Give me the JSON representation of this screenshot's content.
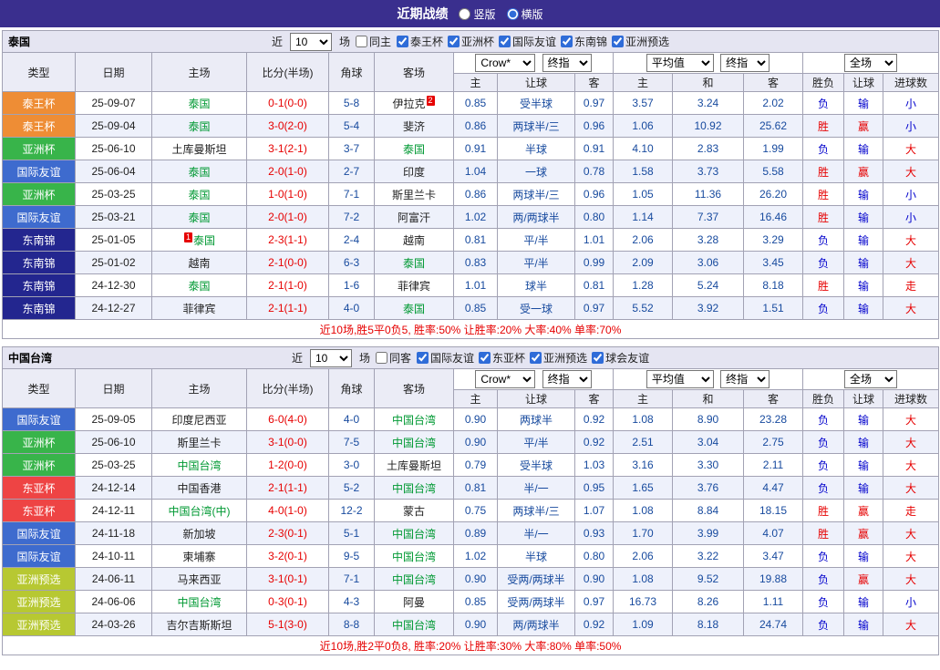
{
  "topbar": {
    "title": "近期战绩",
    "options": [
      {
        "label": "竖版",
        "selected": false
      },
      {
        "label": "横版",
        "selected": true
      }
    ]
  },
  "table_headers": {
    "main": [
      "类型",
      "日期",
      "主场",
      "比分(半场)",
      "角球",
      "客场"
    ],
    "sub": [
      "主",
      "让球",
      "客",
      "主",
      "和",
      "客",
      "胜负",
      "让球",
      "进球数"
    ],
    "dropdowns": {
      "bookmaker": "Crow*",
      "final_odds": "终指",
      "average": "平均值",
      "final_odds2": "终指",
      "scope": "全场"
    }
  },
  "type_colors": {
    "泰王杯": "#ee8d35",
    "亚洲杯": "#38b44a",
    "国际友谊": "#3e6bce",
    "东南锦": "#23268f",
    "东亚杯": "#ee4444",
    "亚洲预选": "#b7c832"
  },
  "colors": {
    "topbar_bg": "#3a2f8e",
    "win_red": "#e60000",
    "loss_blue": "#0000cc",
    "odds_navy": "#174a9e",
    "team_green": "#009933"
  },
  "sections": [
    {
      "team": "泰国",
      "filter": {
        "near": "近",
        "count": "10",
        "games": "场",
        "same_side": "同主",
        "same_checked": false,
        "competitions": [
          "泰王杯",
          "亚洲杯",
          "国际友谊",
          "东南锦",
          "亚洲预选"
        ]
      },
      "rows": [
        {
          "type": "泰王杯",
          "date": "25-09-07",
          "home": {
            "name": "泰国",
            "green": true
          },
          "score": "0-1(0-0)",
          "corner": "5-8",
          "away": {
            "name": "伊拉克",
            "rank": "2"
          },
          "odds": [
            "0.85",
            "受半球",
            "0.97"
          ],
          "avg": [
            "3.57",
            "3.24",
            "2.02"
          ],
          "results": [
            [
              "负",
              "b"
            ],
            [
              "输",
              "b"
            ],
            [
              "小",
              "b"
            ]
          ]
        },
        {
          "type": "泰王杯",
          "date": "25-09-04",
          "home": {
            "name": "泰国",
            "green": true
          },
          "score": "3-0(2-0)",
          "corner": "5-4",
          "away": {
            "name": "斐济"
          },
          "odds": [
            "0.86",
            "两球半/三",
            "0.96"
          ],
          "avg": [
            "1.06",
            "10.92",
            "25.62"
          ],
          "results": [
            [
              "胜",
              "r"
            ],
            [
              "赢",
              "r"
            ],
            [
              "小",
              "b"
            ]
          ]
        },
        {
          "type": "亚洲杯",
          "date": "25-06-10",
          "home": {
            "name": "土库曼斯坦"
          },
          "score": "3-1(2-1)",
          "corner": "3-7",
          "away": {
            "name": "泰国",
            "green": true
          },
          "odds": [
            "0.91",
            "半球",
            "0.91"
          ],
          "avg": [
            "4.10",
            "2.83",
            "1.99"
          ],
          "results": [
            [
              "负",
              "b"
            ],
            [
              "输",
              "b"
            ],
            [
              "大",
              "r"
            ]
          ]
        },
        {
          "type": "国际友谊",
          "date": "25-06-04",
          "home": {
            "name": "泰国",
            "green": true
          },
          "score": "2-0(1-0)",
          "corner": "2-7",
          "away": {
            "name": "印度"
          },
          "odds": [
            "1.04",
            "一球",
            "0.78"
          ],
          "avg": [
            "1.58",
            "3.73",
            "5.58"
          ],
          "results": [
            [
              "胜",
              "r"
            ],
            [
              "赢",
              "r"
            ],
            [
              "大",
              "r"
            ]
          ]
        },
        {
          "type": "亚洲杯",
          "date": "25-03-25",
          "home": {
            "name": "泰国",
            "green": true
          },
          "score": "1-0(1-0)",
          "corner": "7-1",
          "away": {
            "name": "斯里兰卡"
          },
          "odds": [
            "0.86",
            "两球半/三",
            "0.96"
          ],
          "avg": [
            "1.05",
            "11.36",
            "26.20"
          ],
          "results": [
            [
              "胜",
              "r"
            ],
            [
              "输",
              "b"
            ],
            [
              "小",
              "b"
            ]
          ]
        },
        {
          "type": "国际友谊",
          "date": "25-03-21",
          "home": {
            "name": "泰国",
            "green": true
          },
          "score": "2-0(1-0)",
          "corner": "7-2",
          "away": {
            "name": "阿富汗"
          },
          "odds": [
            "1.02",
            "两/两球半",
            "0.80"
          ],
          "avg": [
            "1.14",
            "7.37",
            "16.46"
          ],
          "results": [
            [
              "胜",
              "r"
            ],
            [
              "输",
              "b"
            ],
            [
              "小",
              "b"
            ]
          ]
        },
        {
          "type": "东南锦",
          "date": "25-01-05",
          "home": {
            "name": "泰国",
            "green": true,
            "rank": "1",
            "rank_pos": "before"
          },
          "score": "2-3(1-1)",
          "corner": "2-4",
          "away": {
            "name": "越南"
          },
          "odds": [
            "0.81",
            "平/半",
            "1.01"
          ],
          "avg": [
            "2.06",
            "3.28",
            "3.29"
          ],
          "results": [
            [
              "负",
              "b"
            ],
            [
              "输",
              "b"
            ],
            [
              "大",
              "r"
            ]
          ]
        },
        {
          "type": "东南锦",
          "date": "25-01-02",
          "home": {
            "name": "越南"
          },
          "score": "2-1(0-0)",
          "corner": "6-3",
          "away": {
            "name": "泰国",
            "green": true
          },
          "odds": [
            "0.83",
            "平/半",
            "0.99"
          ],
          "avg": [
            "2.09",
            "3.06",
            "3.45"
          ],
          "results": [
            [
              "负",
              "b"
            ],
            [
              "输",
              "b"
            ],
            [
              "大",
              "r"
            ]
          ]
        },
        {
          "type": "东南锦",
          "date": "24-12-30",
          "home": {
            "name": "泰国",
            "green": true
          },
          "score": "2-1(1-0)",
          "corner": "1-6",
          "away": {
            "name": "菲律宾"
          },
          "odds": [
            "1.01",
            "球半",
            "0.81"
          ],
          "avg": [
            "1.28",
            "5.24",
            "8.18"
          ],
          "results": [
            [
              "胜",
              "r"
            ],
            [
              "输",
              "b"
            ],
            [
              "走",
              "r"
            ]
          ]
        },
        {
          "type": "东南锦",
          "date": "24-12-27",
          "home": {
            "name": "菲律宾"
          },
          "score": "2-1(1-1)",
          "corner": "4-0",
          "away": {
            "name": "泰国",
            "green": true
          },
          "odds": [
            "0.85",
            "受一球",
            "0.97"
          ],
          "avg": [
            "5.52",
            "3.92",
            "1.51"
          ],
          "results": [
            [
              "负",
              "b"
            ],
            [
              "输",
              "b"
            ],
            [
              "大",
              "r"
            ]
          ]
        }
      ],
      "summary": "近10场,胜5平0负5, 胜率:50% 让胜率:20% 大率:40% 单率:70%"
    },
    {
      "team": "中国台湾",
      "filter": {
        "near": "近",
        "count": "10",
        "games": "场",
        "same_side": "同客",
        "same_checked": false,
        "competitions": [
          "国际友谊",
          "东亚杯",
          "亚洲预选",
          "球会友谊"
        ]
      },
      "rows": [
        {
          "type": "国际友谊",
          "date": "25-09-05",
          "home": {
            "name": "印度尼西亚"
          },
          "score": "6-0(4-0)",
          "corner": "4-0",
          "away": {
            "name": "中国台湾",
            "green": true
          },
          "odds": [
            "0.90",
            "两球半",
            "0.92"
          ],
          "avg": [
            "1.08",
            "8.90",
            "23.28"
          ],
          "results": [
            [
              "负",
              "b"
            ],
            [
              "输",
              "b"
            ],
            [
              "大",
              "r"
            ]
          ]
        },
        {
          "type": "亚洲杯",
          "date": "25-06-10",
          "home": {
            "name": "斯里兰卡"
          },
          "score": "3-1(0-0)",
          "corner": "7-5",
          "away": {
            "name": "中国台湾",
            "green": true
          },
          "odds": [
            "0.90",
            "平/半",
            "0.92"
          ],
          "avg": [
            "2.51",
            "3.04",
            "2.75"
          ],
          "results": [
            [
              "负",
              "b"
            ],
            [
              "输",
              "b"
            ],
            [
              "大",
              "r"
            ]
          ]
        },
        {
          "type": "亚洲杯",
          "date": "25-03-25",
          "home": {
            "name": "中国台湾",
            "green": true
          },
          "score": "1-2(0-0)",
          "corner": "3-0",
          "away": {
            "name": "土库曼斯坦"
          },
          "odds": [
            "0.79",
            "受半球",
            "1.03"
          ],
          "avg": [
            "3.16",
            "3.30",
            "2.11"
          ],
          "results": [
            [
              "负",
              "b"
            ],
            [
              "输",
              "b"
            ],
            [
              "大",
              "r"
            ]
          ]
        },
        {
          "type": "东亚杯",
          "date": "24-12-14",
          "home": {
            "name": "中国香港"
          },
          "score": "2-1(1-1)",
          "corner": "5-2",
          "away": {
            "name": "中国台湾",
            "green": true
          },
          "odds": [
            "0.81",
            "半/一",
            "0.95"
          ],
          "avg": [
            "1.65",
            "3.76",
            "4.47"
          ],
          "results": [
            [
              "负",
              "b"
            ],
            [
              "输",
              "b"
            ],
            [
              "大",
              "r"
            ]
          ]
        },
        {
          "type": "东亚杯",
          "date": "24-12-11",
          "home": {
            "name": "中国台湾(中)",
            "green": true
          },
          "score": "4-0(1-0)",
          "corner": "12-2",
          "away": {
            "name": "蒙古"
          },
          "odds": [
            "0.75",
            "两球半/三",
            "1.07"
          ],
          "avg": [
            "1.08",
            "8.84",
            "18.15"
          ],
          "results": [
            [
              "胜",
              "r"
            ],
            [
              "赢",
              "r"
            ],
            [
              "走",
              "r"
            ]
          ]
        },
        {
          "type": "国际友谊",
          "date": "24-11-18",
          "home": {
            "name": "新加坡"
          },
          "score": "2-3(0-1)",
          "corner": "5-1",
          "away": {
            "name": "中国台湾",
            "green": true
          },
          "odds": [
            "0.89",
            "半/一",
            "0.93"
          ],
          "avg": [
            "1.70",
            "3.99",
            "4.07"
          ],
          "results": [
            [
              "胜",
              "r"
            ],
            [
              "赢",
              "r"
            ],
            [
              "大",
              "r"
            ]
          ]
        },
        {
          "type": "国际友谊",
          "date": "24-10-11",
          "home": {
            "name": "柬埔寨"
          },
          "score": "3-2(0-1)",
          "corner": "9-5",
          "away": {
            "name": "中国台湾",
            "green": true
          },
          "odds": [
            "1.02",
            "半球",
            "0.80"
          ],
          "avg": [
            "2.06",
            "3.22",
            "3.47"
          ],
          "results": [
            [
              "负",
              "b"
            ],
            [
              "输",
              "b"
            ],
            [
              "大",
              "r"
            ]
          ]
        },
        {
          "type": "亚洲预选",
          "date": "24-06-11",
          "home": {
            "name": "马来西亚"
          },
          "score": "3-1(0-1)",
          "corner": "7-1",
          "away": {
            "name": "中国台湾",
            "green": true
          },
          "odds": [
            "0.90",
            "受两/两球半",
            "0.90"
          ],
          "avg": [
            "1.08",
            "9.52",
            "19.88"
          ],
          "results": [
            [
              "负",
              "b"
            ],
            [
              "赢",
              "r"
            ],
            [
              "大",
              "r"
            ]
          ]
        },
        {
          "type": "亚洲预选",
          "date": "24-06-06",
          "home": {
            "name": "中国台湾",
            "green": true
          },
          "score": "0-3(0-1)",
          "corner": "4-3",
          "away": {
            "name": "阿曼"
          },
          "odds": [
            "0.85",
            "受两/两球半",
            "0.97"
          ],
          "avg": [
            "16.73",
            "8.26",
            "1.11"
          ],
          "results": [
            [
              "负",
              "b"
            ],
            [
              "输",
              "b"
            ],
            [
              "小",
              "b"
            ]
          ]
        },
        {
          "type": "亚洲预选",
          "date": "24-03-26",
          "home": {
            "name": "吉尔吉斯斯坦"
          },
          "score": "5-1(3-0)",
          "corner": "8-8",
          "away": {
            "name": "中国台湾",
            "green": true
          },
          "odds": [
            "0.90",
            "两/两球半",
            "0.92"
          ],
          "avg": [
            "1.09",
            "8.18",
            "24.74"
          ],
          "results": [
            [
              "负",
              "b"
            ],
            [
              "输",
              "b"
            ],
            [
              "大",
              "r"
            ]
          ]
        }
      ],
      "summary": "近10场,胜2平0负8, 胜率:20% 让胜率:30% 大率:80% 单率:50%"
    }
  ]
}
